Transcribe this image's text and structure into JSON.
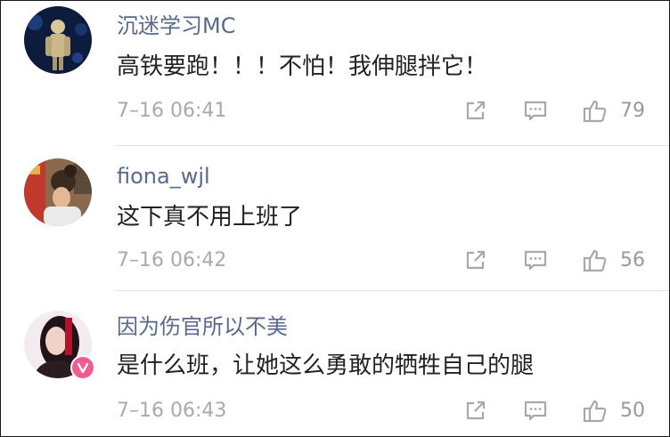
{
  "comments": [
    {
      "username": "沉迷学习MC",
      "text": "高铁要跑！！！不怕！我伸腿拌它！",
      "time": "7–16 06:41",
      "likes": "79"
    },
    {
      "username": "fiona_wjl",
      "text": "这下真不用上班了",
      "time": "7–16 06:42",
      "likes": "56"
    },
    {
      "username": "因为伤官所以不美",
      "text": "是什么班，让她这么勇敢的牺牲自己的腿",
      "time": "7–16 06:43",
      "likes": "50"
    }
  ],
  "icons": {
    "share": "share-icon",
    "reply": "comment-icon",
    "like": "thumbs-up-icon",
    "vip": "vip-badge-icon"
  },
  "colors": {
    "username": "#596a8c",
    "text": "#222222",
    "meta": "#aaaaaa",
    "vip_badge": "#f25b8f"
  }
}
